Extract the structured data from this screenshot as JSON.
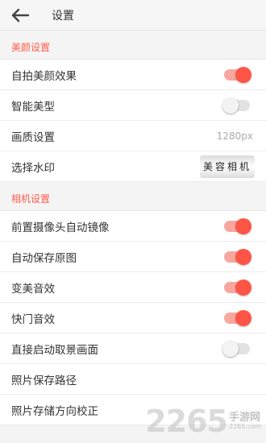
{
  "header": {
    "title": "设置"
  },
  "beauty_section": {
    "title": "美颜设置",
    "rows": [
      {
        "label": "自拍美颜效果",
        "toggle": "on"
      },
      {
        "label": "智能美型",
        "toggle": "off"
      },
      {
        "label": "画质设置",
        "value": "1280px"
      },
      {
        "label": "选择水印",
        "watermark_text": "美容相机"
      }
    ]
  },
  "camera_section": {
    "title": "相机设置",
    "rows": [
      {
        "label": "前置摄像头自动镜像",
        "toggle": "on"
      },
      {
        "label": "自动保存原图",
        "toggle": "on"
      },
      {
        "label": "变美音效",
        "toggle": "on"
      },
      {
        "label": "快门音效",
        "toggle": "on"
      },
      {
        "label": "直接启动取景画面",
        "toggle": "off"
      },
      {
        "label": "照片保存路径"
      },
      {
        "label": "照片存储方向校正"
      }
    ]
  },
  "brand": {
    "number": "2265",
    "cn": "手游网",
    "url": "2265.com"
  },
  "colors": {
    "accent": "#ff5546",
    "section_title": "#ff5b4b"
  }
}
